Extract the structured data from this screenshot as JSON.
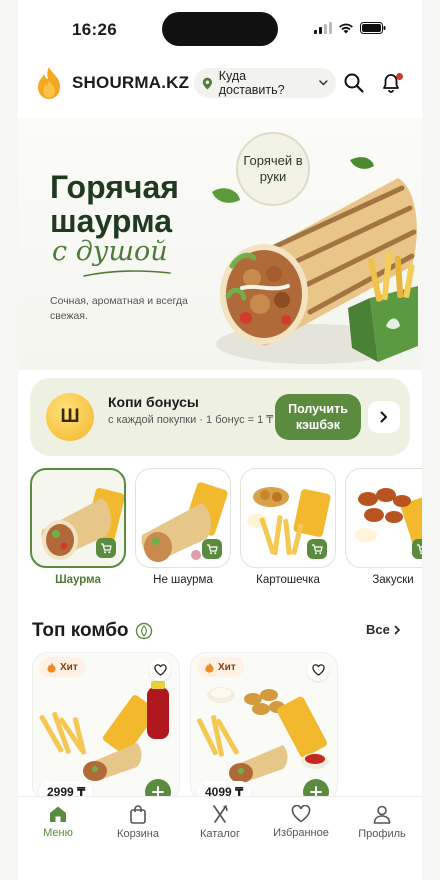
{
  "status": {
    "time": "16:26"
  },
  "header": {
    "brand": "SHOURMA.KZ",
    "deliver_label": "Куда доставить?"
  },
  "hero": {
    "title_line1": "Горячая",
    "title_line2": "шаурма",
    "script": "с душой",
    "subtitle": "Сочная, ароматная и всегда свежая.",
    "badge": "Горячей в руки"
  },
  "bonus": {
    "coin_letter": "Ш",
    "title": "Копи бонусы",
    "subtitle": "с каждой покупки · 1 бонус = 1 ₸",
    "button": "Получить кэшбэк"
  },
  "categories": [
    {
      "label": "Шаурма",
      "active": true
    },
    {
      "label": "Не шаурма",
      "active": false
    },
    {
      "label": "Картошечка",
      "active": false
    },
    {
      "label": "Закуски",
      "active": false
    }
  ],
  "section": {
    "title": "Топ комбо",
    "see_all": "Все"
  },
  "combos": [
    {
      "badge": "Хит",
      "price": "2999 ₸"
    },
    {
      "badge": "Хит",
      "price": "4099 ₸"
    }
  ],
  "tabs": [
    {
      "label": "Меню",
      "icon": "home-icon",
      "active": true
    },
    {
      "label": "Корзина",
      "icon": "bag-icon",
      "active": false
    },
    {
      "label": "Каталог",
      "icon": "fork-knife-icon",
      "active": false
    },
    {
      "label": "Избранное",
      "icon": "heart-icon",
      "active": false
    },
    {
      "label": "Профиль",
      "icon": "user-icon",
      "active": false
    }
  ],
  "colors": {
    "accent": "#5a8b3f",
    "dark_green": "#1f3a1e",
    "bonus_bg": "#eef0e2",
    "hit_bg": "#fff1e4"
  }
}
